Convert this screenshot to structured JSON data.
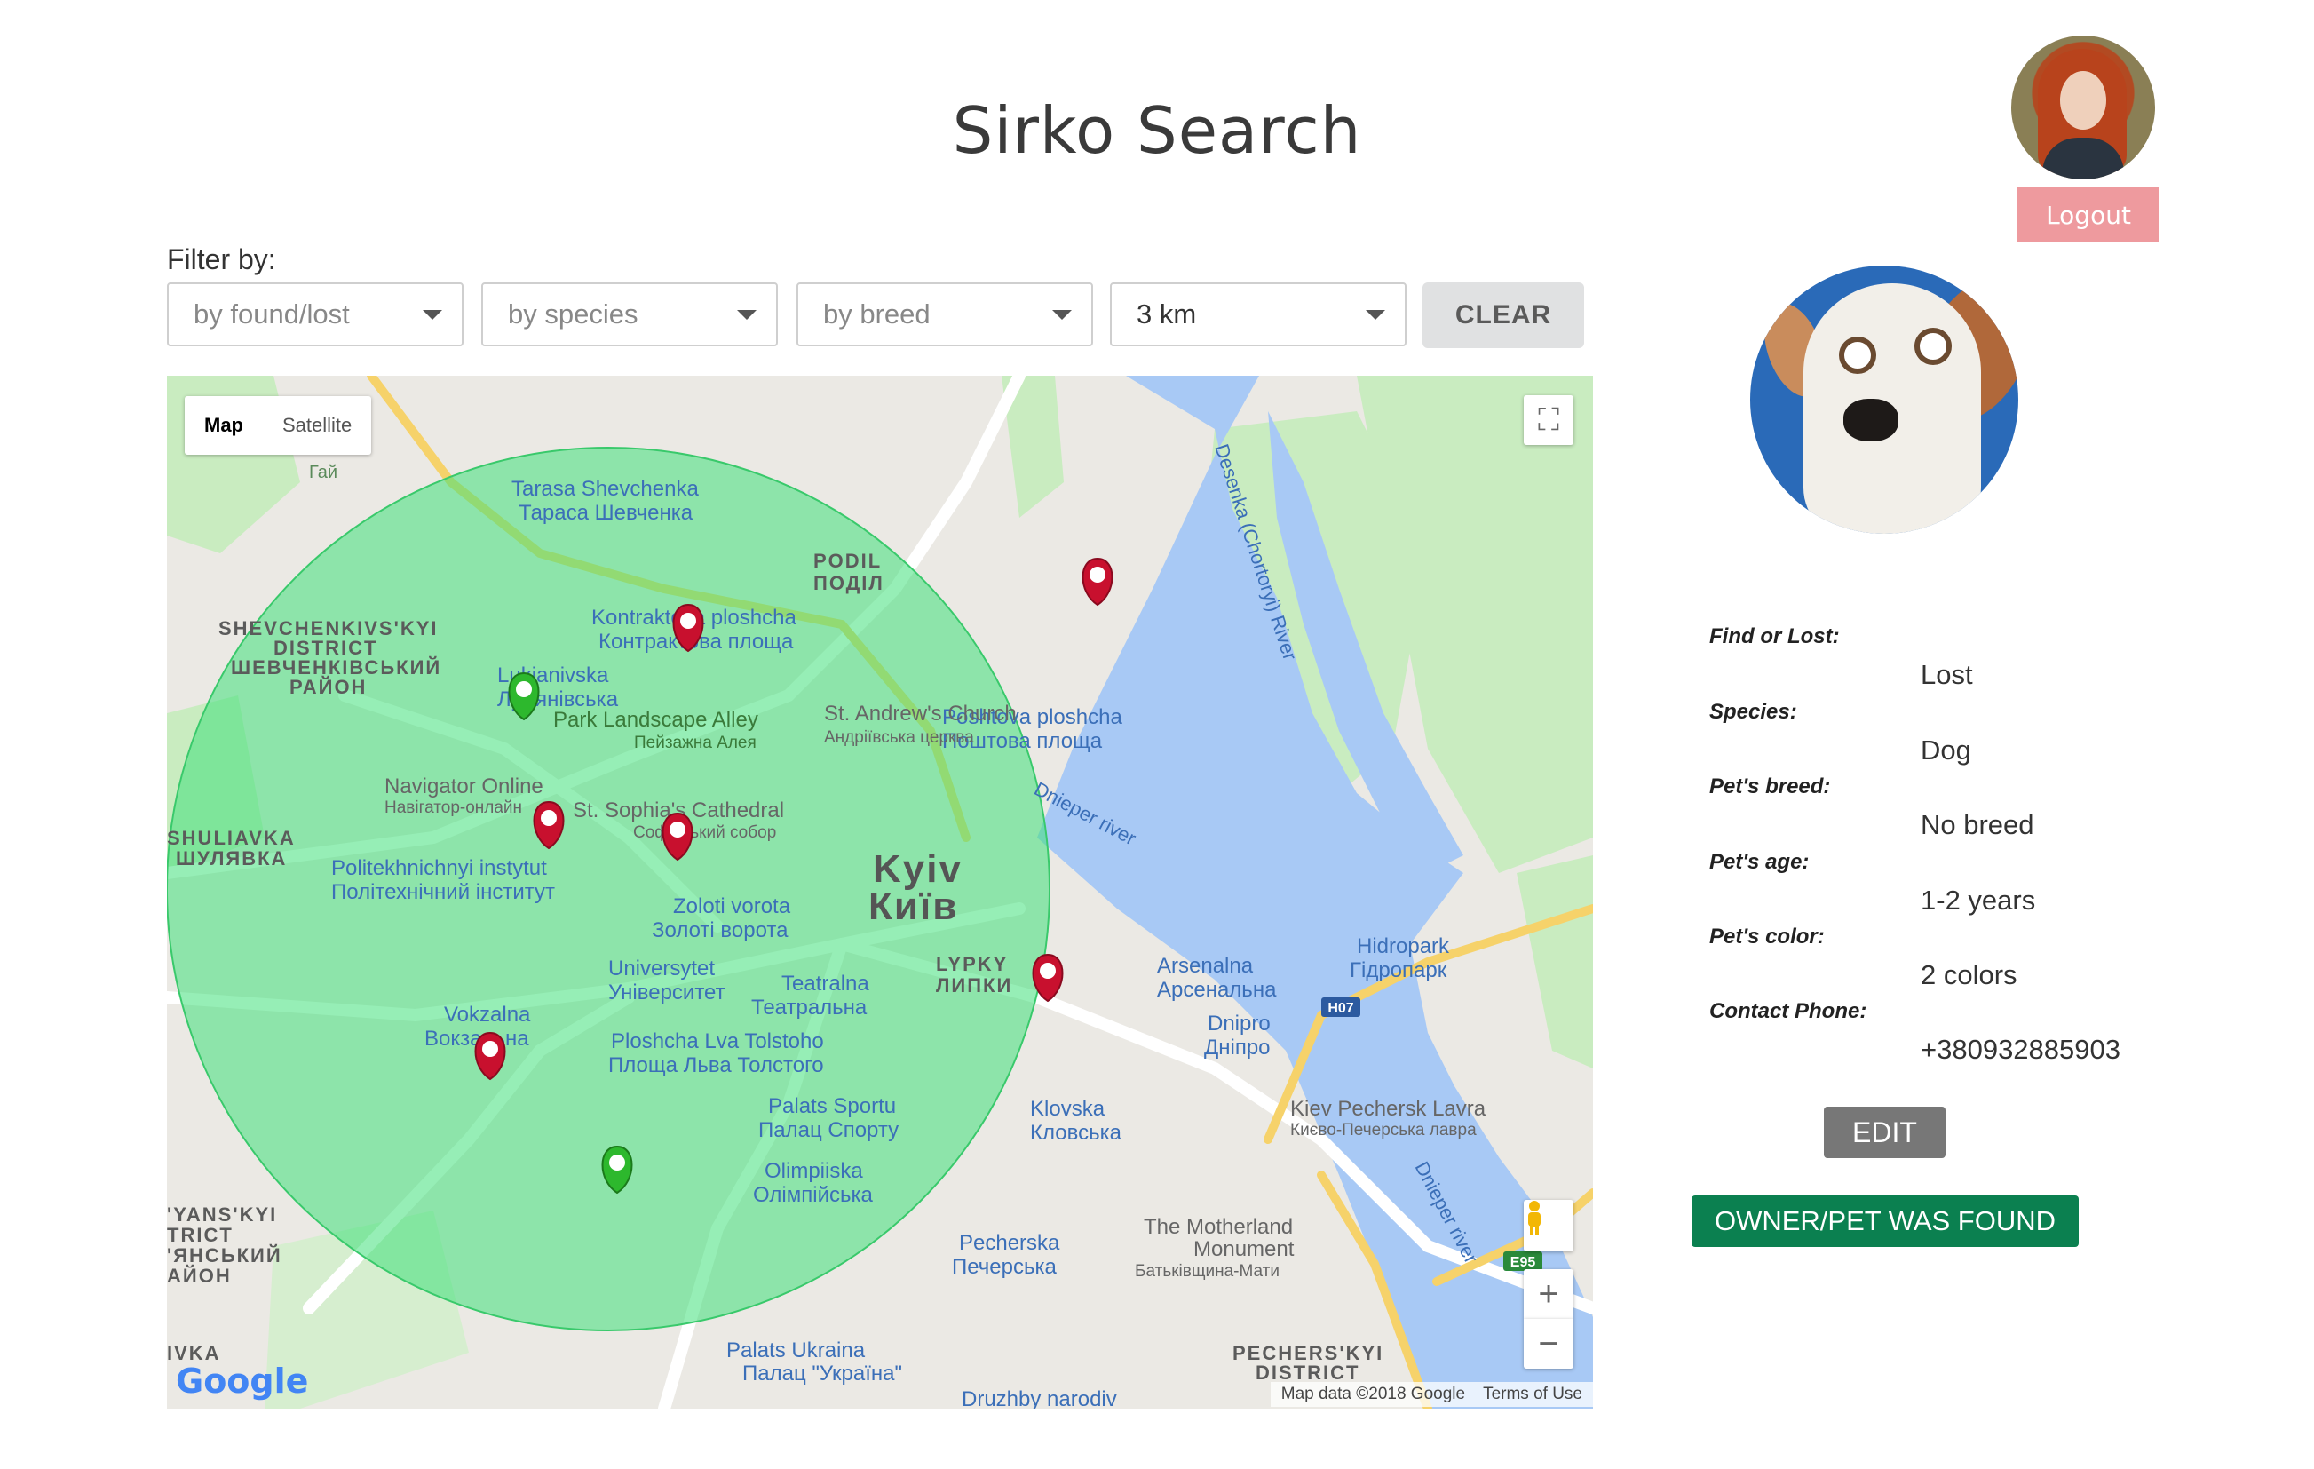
{
  "header": {
    "title": "Sirko Search",
    "logout_label": "Logout"
  },
  "filters": {
    "label": "Filter by:",
    "found_lost": "by found/lost",
    "species": "by species",
    "breed": "by breed",
    "radius": "3 km",
    "clear_label": "CLEAR"
  },
  "map": {
    "type_map": "Map",
    "type_satellite": "Satellite",
    "labels": {
      "shevchenko_en": "Tarasa Shevchenka",
      "shevchenko_ua": "Тараса Шевченка",
      "podil_en": "PODIL",
      "podil_ua": "ПОДІЛ",
      "shevchenkivskyi1": "SHEVCHENKIVS'KYI",
      "shevchenkivskyi2": "DISTRICT",
      "shevchenkivskyi3": "ШЕВЧЕНКІВСЬКИЙ",
      "shevchenkivskyi4": "РАЙОН",
      "kontraktova_en": "Kontraktova ploshcha",
      "kontraktova_ua": "Контрактова площа",
      "andrews_en": "St. Andrew's Church",
      "andrews_ua": "Андріївська церква",
      "lukianivska_en": "Lukianivska",
      "lukianivska_ua": "Лук'янівська",
      "park_en": "Park Landscape Alley",
      "park_ua": "Пейзажна Алея",
      "poshtova_en": "Poshtova ploshcha",
      "poshtova_ua": "Поштова площа",
      "navigator_en": "Navigator Online",
      "navigator_ua": "Навігатор-онлайн",
      "sophia_en": "St. Sophia's Cathedral",
      "sophia_ua": "Софійський собор",
      "shuliavka_en": "SHULIAVKA",
      "shuliavka_ua": "ШУЛЯВКА",
      "poli_en": "Politekhnichnyi instytut",
      "poli_ua": "Політехнічний інститут",
      "kyiv_en": "Kyiv",
      "kyiv_ua": "Київ",
      "zoloti_en": "Zoloti vorota",
      "zoloti_ua": "Золоті ворота",
      "universytet_en": "Universytet",
      "universytet_ua": "Університет",
      "teatralna_en": "Teatralna",
      "teatralna_ua": "Театральна",
      "lypky_en": "LYPKY",
      "lypky_ua": "ЛИПКИ",
      "arsenalna_en": "Arsenalna",
      "arsenalna_ua": "Арсенальна",
      "hidropark_en": "Hidropark",
      "hidropark_ua": "Гідропарк",
      "vokzalna_en": "Vokzalna",
      "vokzalna_ua": "Вокзальна",
      "lva_en": "Ploshcha Lva Tolstoho",
      "lva_ua": "Площа Льва Толстого",
      "dnipro_en": "Dnipro",
      "dnipro_ua": "Дніпро",
      "h07": "H07",
      "sportu_en": "Palats Sportu",
      "sportu_ua": "Палац Спорту",
      "klovska_en": "Klovska",
      "klovska_ua": "Кловська",
      "lavra_en": "Kiev Pechersk Lavra",
      "lavra_ua": "Києво-Печерська лавра",
      "olimp_en": "Olimpiiska",
      "olimp_ua": "Олімпійська",
      "motherland1": "The Motherland",
      "motherland2": "Monument",
      "motherland_ua": "Батьківщина-Мати",
      "e95": "E95",
      "pecherska_en": "Pecherska",
      "pecherska_ua": "Печерська",
      "ukraina_en": "Palats Ukraina",
      "ukraina_ua": "Палац \"Україна\"",
      "solomianskyi1": "'YANS'KYI",
      "solomianskyi2": "TRICT",
      "solomianskyi3": "'ЯНСЬКИЙ",
      "solomianskyi4": "АЙОН",
      "pecherskyi1": "PECHERS'KYI",
      "pecherskyi2": "DISTRICT",
      "druzhby": "Druzhby narodiv",
      "dnieper1": "Dnieper river",
      "dnieper2": "Dnieper river",
      "desenka": "Desenka (Chortoryi) River",
      "ivka": "IVKA",
      "gai": "Гай"
    },
    "google_logo": "Google",
    "attribution": "Map data ©2018 Google",
    "terms": "Terms of Use"
  },
  "pet": {
    "labels": {
      "status": "Find or Lost:",
      "species": "Species:",
      "breed": "Pet's breed:",
      "age": "Pet's age:",
      "color": "Pet's color:",
      "phone": "Contact Phone:"
    },
    "values": {
      "status": "Lost",
      "species": "Dog",
      "breed": "No breed",
      "age": "1-2 years",
      "color": "2 colors",
      "phone": "+380932885903"
    },
    "edit_label": "EDIT",
    "found_label": "OWNER/PET WAS FOUND"
  },
  "colors": {
    "radius_fill": "#3fe07a",
    "lost_pin": "#c8102e",
    "found_pin": "#2db82d",
    "found_button": "#0b8050",
    "logout": "#ee9a9e"
  }
}
